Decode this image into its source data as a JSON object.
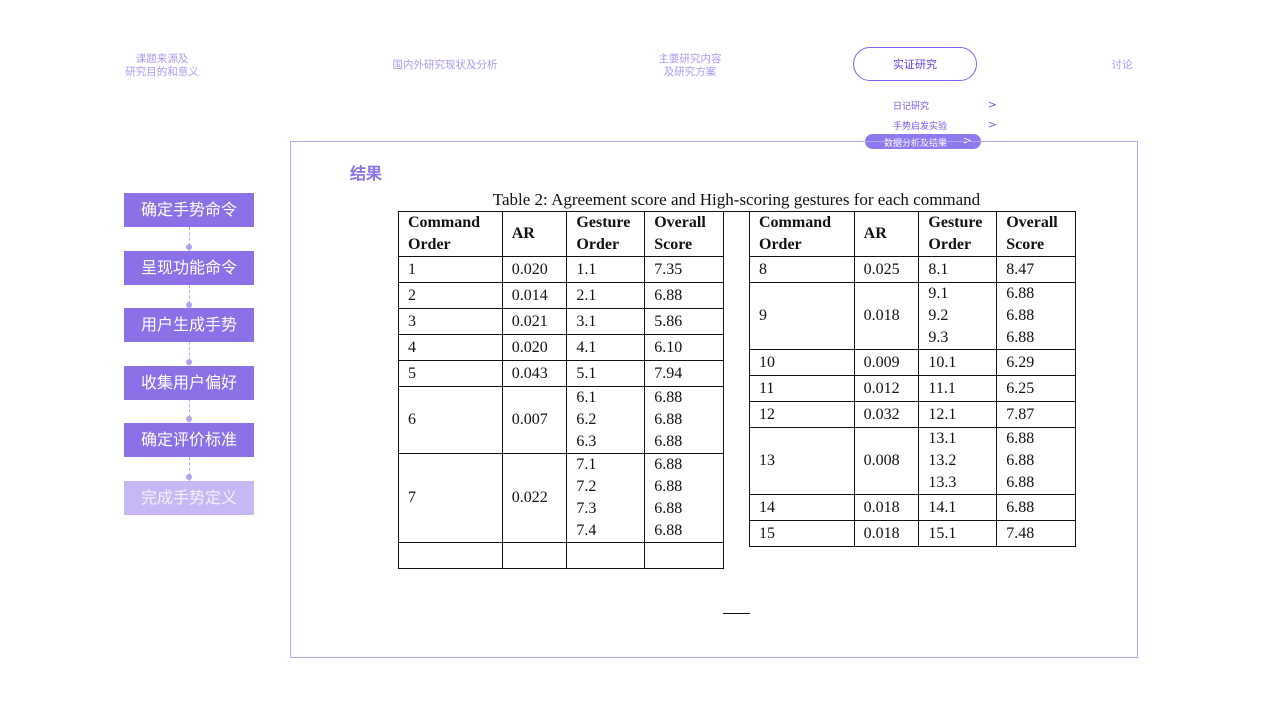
{
  "nav": {
    "items": [
      {
        "lines": [
          "课题来源及",
          "研究目的和意义"
        ]
      },
      {
        "lines": [
          "国内外研究现状及分析"
        ]
      },
      {
        "lines": [
          "主要研究内容",
          "及研究方案"
        ]
      },
      {
        "lines": [
          "实证研究"
        ]
      },
      {
        "lines": [
          "讨论"
        ]
      }
    ],
    "active": "实证研究",
    "sub_items": [
      {
        "label": "日记研究",
        "chevron": ">"
      },
      {
        "label": "手势启发实验",
        "chevron": ">"
      },
      {
        "label": "数据分析及结果",
        "chevron": ">"
      }
    ],
    "accent_color": "#8b70e8"
  },
  "steps": [
    {
      "label": "确定手势命令"
    },
    {
      "label": "呈现功能命令"
    },
    {
      "label": "用户生成手势"
    },
    {
      "label": "收集用户偏好"
    },
    {
      "label": "确定评价标准"
    },
    {
      "label": "完成手势定义"
    }
  ],
  "section_title": "结果",
  "table": {
    "caption": "Table 2: Agreement score and High-scoring gestures for each command",
    "headers": [
      "Command Order",
      "AR",
      "Gesture Order",
      "Overall Score"
    ],
    "left_rows": [
      {
        "cmd": "1",
        "ar": "0.020",
        "gestures": [
          "1.1"
        ],
        "scores": [
          "7.35"
        ]
      },
      {
        "cmd": "2",
        "ar": "0.014",
        "gestures": [
          "2.1"
        ],
        "scores": [
          "6.88"
        ]
      },
      {
        "cmd": "3",
        "ar": "0.021",
        "gestures": [
          "3.1"
        ],
        "scores": [
          "5.86"
        ]
      },
      {
        "cmd": "4",
        "ar": "0.020",
        "gestures": [
          "4.1"
        ],
        "scores": [
          "6.10"
        ]
      },
      {
        "cmd": "5",
        "ar": "0.043",
        "gestures": [
          "5.1"
        ],
        "scores": [
          "7.94"
        ]
      },
      {
        "cmd": "6",
        "ar": "0.007",
        "gestures": [
          "6.1",
          "6.2",
          "6.3"
        ],
        "scores": [
          "6.88",
          "6.88",
          "6.88"
        ]
      },
      {
        "cmd": "7",
        "ar": "0.022",
        "gestures": [
          "7.1",
          "7.2",
          "7.3",
          "7.4"
        ],
        "scores": [
          "6.88",
          "6.88",
          "6.88",
          "6.88"
        ]
      },
      {
        "cmd": "",
        "ar": "",
        "gestures": [
          ""
        ],
        "scores": [
          ""
        ]
      }
    ],
    "right_rows": [
      {
        "cmd": "8",
        "ar": "0.025",
        "gestures": [
          "8.1"
        ],
        "scores": [
          "8.47"
        ]
      },
      {
        "cmd": "9",
        "ar": "0.018",
        "gestures": [
          "9.1",
          "9.2",
          "9.3"
        ],
        "scores": [
          "6.88",
          "6.88",
          "6.88"
        ]
      },
      {
        "cmd": "10",
        "ar": "0.009",
        "gestures": [
          "10.1"
        ],
        "scores": [
          "6.29"
        ]
      },
      {
        "cmd": "11",
        "ar": "0.012",
        "gestures": [
          "11.1"
        ],
        "scores": [
          "6.25"
        ]
      },
      {
        "cmd": "12",
        "ar": "0.032",
        "gestures": [
          "12.1"
        ],
        "scores": [
          "7.87"
        ]
      },
      {
        "cmd": "13",
        "ar": "0.008",
        "gestures": [
          "13.1",
          "13.2",
          "13.3"
        ],
        "scores": [
          "6.88",
          "6.88",
          "6.88"
        ]
      },
      {
        "cmd": "14",
        "ar": "0.018",
        "gestures": [
          "14.1"
        ],
        "scores": [
          "6.88"
        ]
      },
      {
        "cmd": "15",
        "ar": "0.018",
        "gestures": [
          "15.1"
        ],
        "scores": [
          "7.48"
        ]
      }
    ]
  }
}
